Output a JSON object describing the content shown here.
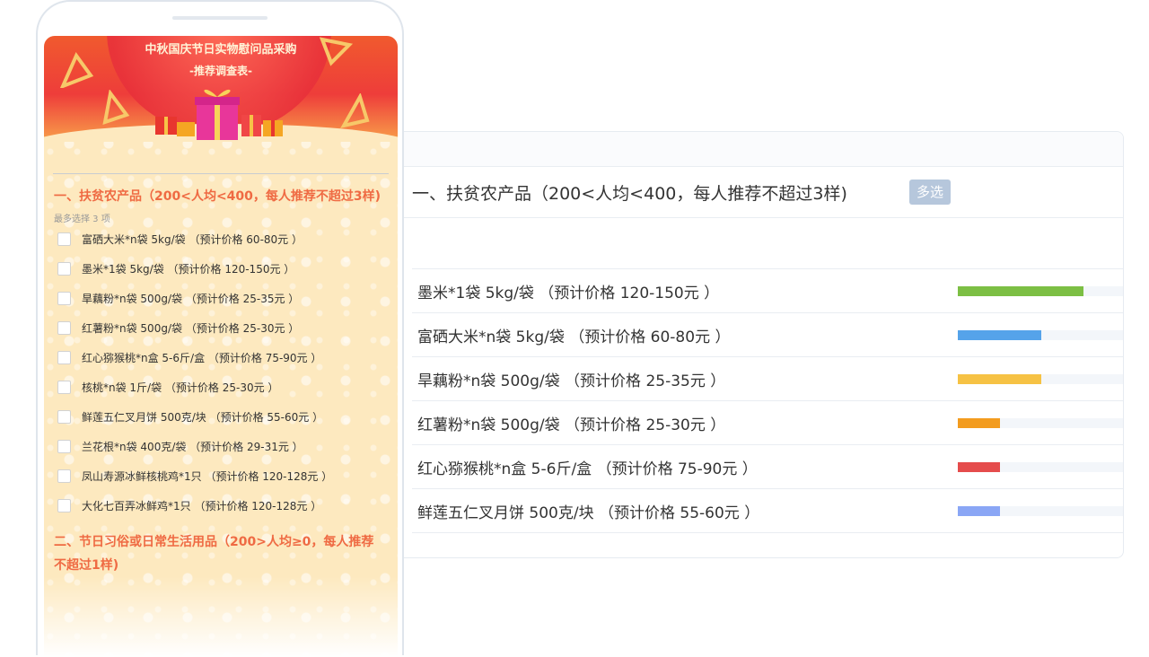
{
  "survey": {
    "banner_title": "中秋国庆节日实物慰问品采购",
    "banner_subtitle": "-推荐调查表-",
    "question1": {
      "title": "一、扶贫农产品（200<人均<400，每人推荐不超过3样)",
      "hint": "最多选择 3 项",
      "options": [
        "富硒大米*n袋 5kg/袋 （预计价格 60-80元 ）",
        "墨米*1袋 5kg/袋 （预计价格 120-150元 ）",
        "旱藕粉*n袋 500g/袋 （预计价格 25-35元 ）",
        "红薯粉*n袋 500g/袋 （预计价格 25-30元 ）",
        "红心猕猴桃*n盒 5-6斤/盒 （预计价格 75-90元 ）",
        "核桃*n袋 1斤/袋 （预计价格 25-30元 ）",
        "鲜莲五仁叉月饼 500克/块 （预计价格 55-60元 ）",
        "兰花根*n袋 400克/袋 （预计价格 29-31元 ）",
        "凤山寿源冰鲜核桃鸡*1只 （预计价格 120-128元 ）",
        "大化七百弄冰鲜鸡*1只 （预计价格 120-128元 ）"
      ]
    },
    "question2": {
      "title": "二、节日习俗或日常生活用品（200>人均≥0，每人推荐不超过1样)"
    }
  },
  "results": {
    "question_title": "一、扶贫农产品（200<人均<400，每人推荐不超过3样)",
    "badge": "多选",
    "rows": [
      {
        "label": "墨米*1袋 5kg/袋 （预计价格 120-150元 ）",
        "fraction": 0.75,
        "color": "#7cbf44"
      },
      {
        "label": "富硒大米*n袋 5kg/袋 （预计价格 60-80元 ）",
        "fraction": 0.5,
        "color": "#55a3ea"
      },
      {
        "label": "旱藕粉*n袋 500g/袋 （预计价格 25-35元 ）",
        "fraction": 0.5,
        "color": "#f6c244"
      },
      {
        "label": "红薯粉*n袋 500g/袋 （预计价格 25-30元 ）",
        "fraction": 0.25,
        "color": "#f39c1f"
      },
      {
        "label": "红心猕猴桃*n盒 5-6斤/盒 （预计价格 75-90元 ）",
        "fraction": 0.25,
        "color": "#e54c4c"
      },
      {
        "label": "鲜莲五仁叉月饼 500克/块 （预计价格 55-60元 ）",
        "fraction": 0.25,
        "color": "#8aa6f5"
      }
    ]
  }
}
